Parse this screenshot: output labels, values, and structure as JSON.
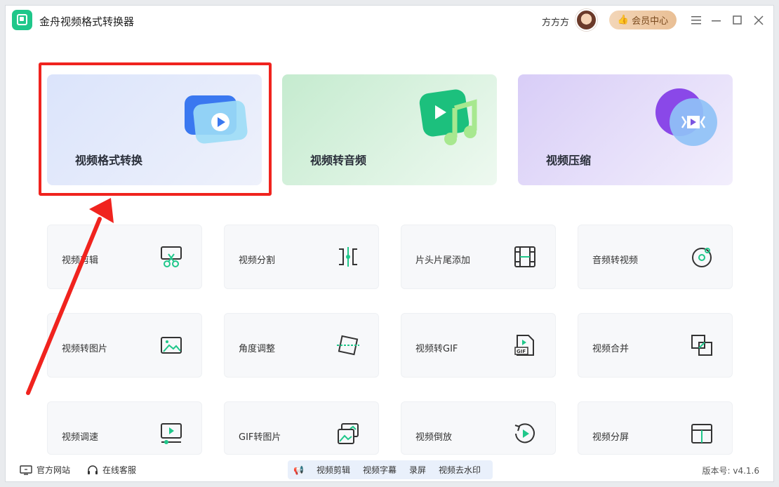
{
  "app": {
    "title": "金舟视频格式转换器"
  },
  "header": {
    "user_name": "方方方",
    "vip_label": "会员中心"
  },
  "hero_cards": [
    {
      "label": "视频格式转换"
    },
    {
      "label": "视频转音频"
    },
    {
      "label": "视频压缩"
    }
  ],
  "tools": [
    {
      "label": "视频剪辑",
      "icon": "scissors-icon"
    },
    {
      "label": "视频分割",
      "icon": "split-icon"
    },
    {
      "label": "片头片尾添加",
      "icon": "film-icon"
    },
    {
      "label": "音频转视频",
      "icon": "music-disc-icon"
    },
    {
      "label": "视频转图片",
      "icon": "image-icon"
    },
    {
      "label": "角度调整",
      "icon": "rotate-frame-icon"
    },
    {
      "label": "视频转GIF",
      "icon": "gif-file-icon"
    },
    {
      "label": "视频合并",
      "icon": "merge-icon"
    },
    {
      "label": "视频调速",
      "icon": "speed-icon"
    },
    {
      "label": "GIF转图片",
      "icon": "gif-image-icon"
    },
    {
      "label": "视频倒放",
      "icon": "reverse-play-icon"
    },
    {
      "label": "视频分屏",
      "icon": "split-screen-icon"
    }
  ],
  "footer": {
    "website": "官方网站",
    "support": "在线客服",
    "quick_tools": [
      "视频剪辑",
      "视频字幕",
      "录屏",
      "视频去水印"
    ],
    "version": "版本号: v4.1.6"
  },
  "colors": {
    "accent": "#1fc78a",
    "highlight": "#f0231e",
    "vip": "#e9bf95"
  }
}
